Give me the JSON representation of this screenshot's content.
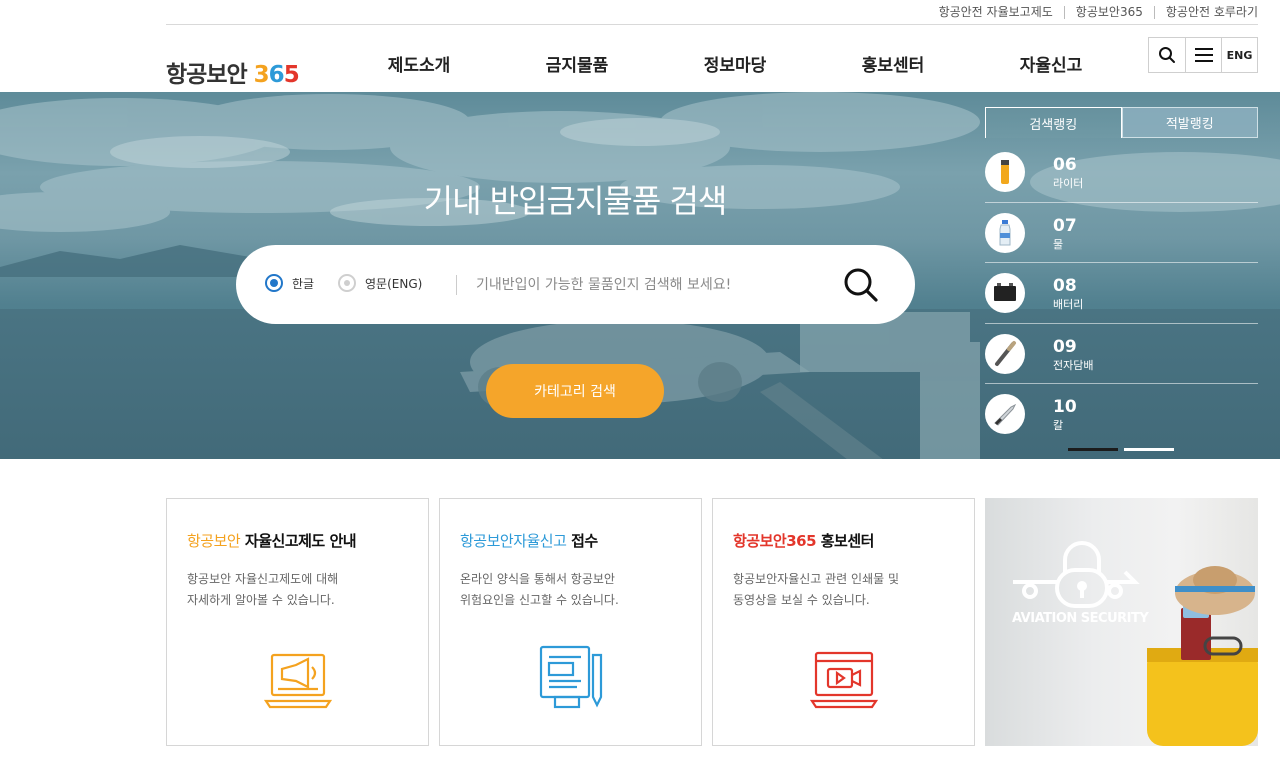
{
  "util_links": [
    "항공안전 자율보고제도",
    "항공보안365",
    "항공안전 호루라기"
  ],
  "logo": {
    "prefix": "항공보안 ",
    "d1": "3",
    "d2": "6",
    "d3": "5"
  },
  "gnb": [
    "제도소개",
    "금지물품",
    "정보마당",
    "홍보센터",
    "자율신고"
  ],
  "tools": {
    "eng_label": "ENG"
  },
  "hero": {
    "title": "기내 반입금지물품 검색",
    "radio_korean": "한글",
    "radio_english": "영문(ENG)",
    "search_placeholder": "기내반입이 가능한 물품인지 검색해 보세요!",
    "category_button": "카테고리 검색"
  },
  "ranking": {
    "tab_search": "검색랭킹",
    "tab_detect": "적발랭킹",
    "items": [
      {
        "num": "06",
        "label": "라이터",
        "icon": "lighter-icon"
      },
      {
        "num": "07",
        "label": "물",
        "icon": "water-bottle-icon"
      },
      {
        "num": "08",
        "label": "배터리",
        "icon": "battery-icon"
      },
      {
        "num": "09",
        "label": "전자담배",
        "icon": "e-cigarette-icon"
      },
      {
        "num": "10",
        "label": "칼",
        "icon": "knife-icon"
      }
    ]
  },
  "cards": [
    {
      "title_accent": "항공보안",
      "title_rest": " 자율신고제도 안내",
      "accent_color": "#f4a21f",
      "desc": "항공보안 자율신고제도에 대해\n자세하게 알아볼 수 있습니다.",
      "icon": "megaphone-laptop-icon"
    },
    {
      "title_accent": "항공보안자율신고",
      "title_rest": " 접수",
      "accent_color": "#2d9ad8",
      "desc": "온라인 양식을 통해서 항공보안\n위험요인을 신고할 수 있습니다.",
      "icon": "document-pencil-icon"
    },
    {
      "title_accent": "항공보안365",
      "title_rest": " 홍보센터",
      "accent_color": "#e3362b",
      "desc": "항공보안자율신고 관련 인쇄물 및\n동영상을 보실 수 있습니다.",
      "icon": "video-monitor-icon"
    }
  ],
  "photo_card": {
    "text": "AVIATION SECURITY"
  }
}
